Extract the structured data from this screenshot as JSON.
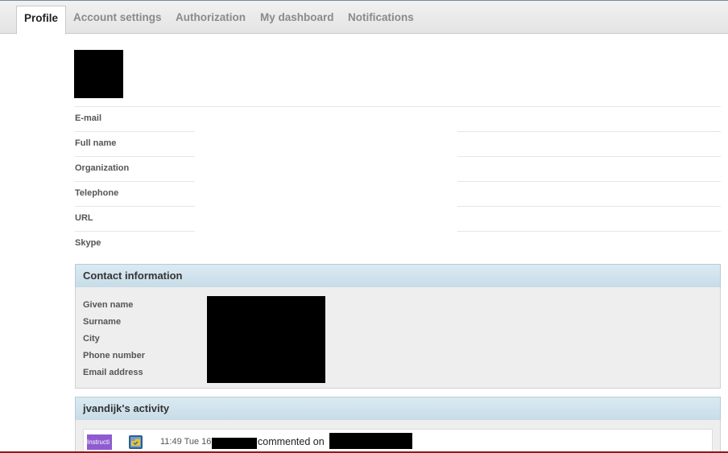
{
  "tabs": [
    {
      "label": "Profile",
      "active": true
    },
    {
      "label": "Account settings",
      "active": false
    },
    {
      "label": "Authorization",
      "active": false
    },
    {
      "label": "My dashboard",
      "active": false
    },
    {
      "label": "Notifications",
      "active": false
    }
  ],
  "profile": {
    "fields": [
      "E-mail",
      "Full name",
      "Organization",
      "Telephone",
      "URL",
      "Skype"
    ]
  },
  "contact": {
    "title": "Contact information",
    "labels": [
      "Given name",
      "Surname",
      "City",
      "Phone number",
      "Email address"
    ]
  },
  "activity": {
    "title": "jvandijk's activity",
    "item": {
      "badge": "Instructi",
      "time": "11:49 Tue 16",
      "action": "commented on",
      "icon": "document-icon"
    }
  },
  "colors": {
    "badge": "#8e5bd0",
    "panel_header": "#c7dce8",
    "bottom_bar": "#8b1a1a"
  }
}
